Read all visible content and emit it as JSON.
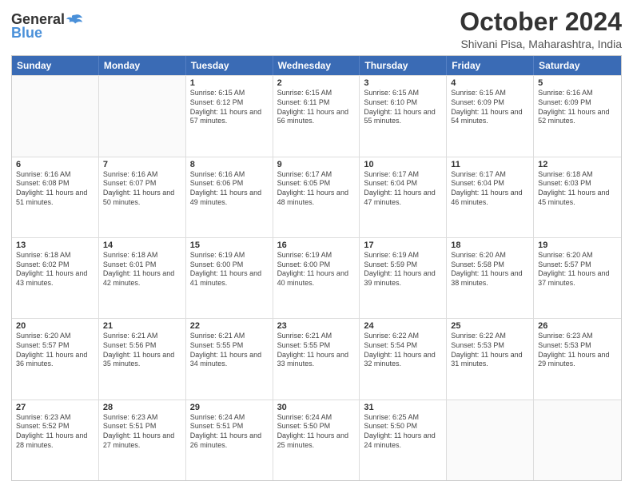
{
  "header": {
    "logo_general": "General",
    "logo_blue": "Blue",
    "month_title": "October 2024",
    "location": "Shivani Pisa, Maharashtra, India"
  },
  "calendar": {
    "days": [
      "Sunday",
      "Monday",
      "Tuesday",
      "Wednesday",
      "Thursday",
      "Friday",
      "Saturday"
    ],
    "rows": [
      [
        {
          "day": "",
          "sunrise": "",
          "sunset": "",
          "daylight": "",
          "empty": true
        },
        {
          "day": "",
          "sunrise": "",
          "sunset": "",
          "daylight": "",
          "empty": true
        },
        {
          "day": "1",
          "sunrise": "Sunrise: 6:15 AM",
          "sunset": "Sunset: 6:12 PM",
          "daylight": "Daylight: 11 hours and 57 minutes."
        },
        {
          "day": "2",
          "sunrise": "Sunrise: 6:15 AM",
          "sunset": "Sunset: 6:11 PM",
          "daylight": "Daylight: 11 hours and 56 minutes."
        },
        {
          "day": "3",
          "sunrise": "Sunrise: 6:15 AM",
          "sunset": "Sunset: 6:10 PM",
          "daylight": "Daylight: 11 hours and 55 minutes."
        },
        {
          "day": "4",
          "sunrise": "Sunrise: 6:15 AM",
          "sunset": "Sunset: 6:09 PM",
          "daylight": "Daylight: 11 hours and 54 minutes."
        },
        {
          "day": "5",
          "sunrise": "Sunrise: 6:16 AM",
          "sunset": "Sunset: 6:09 PM",
          "daylight": "Daylight: 11 hours and 52 minutes."
        }
      ],
      [
        {
          "day": "6",
          "sunrise": "Sunrise: 6:16 AM",
          "sunset": "Sunset: 6:08 PM",
          "daylight": "Daylight: 11 hours and 51 minutes."
        },
        {
          "day": "7",
          "sunrise": "Sunrise: 6:16 AM",
          "sunset": "Sunset: 6:07 PM",
          "daylight": "Daylight: 11 hours and 50 minutes."
        },
        {
          "day": "8",
          "sunrise": "Sunrise: 6:16 AM",
          "sunset": "Sunset: 6:06 PM",
          "daylight": "Daylight: 11 hours and 49 minutes."
        },
        {
          "day": "9",
          "sunrise": "Sunrise: 6:17 AM",
          "sunset": "Sunset: 6:05 PM",
          "daylight": "Daylight: 11 hours and 48 minutes."
        },
        {
          "day": "10",
          "sunrise": "Sunrise: 6:17 AM",
          "sunset": "Sunset: 6:04 PM",
          "daylight": "Daylight: 11 hours and 47 minutes."
        },
        {
          "day": "11",
          "sunrise": "Sunrise: 6:17 AM",
          "sunset": "Sunset: 6:04 PM",
          "daylight": "Daylight: 11 hours and 46 minutes."
        },
        {
          "day": "12",
          "sunrise": "Sunrise: 6:18 AM",
          "sunset": "Sunset: 6:03 PM",
          "daylight": "Daylight: 11 hours and 45 minutes."
        }
      ],
      [
        {
          "day": "13",
          "sunrise": "Sunrise: 6:18 AM",
          "sunset": "Sunset: 6:02 PM",
          "daylight": "Daylight: 11 hours and 43 minutes."
        },
        {
          "day": "14",
          "sunrise": "Sunrise: 6:18 AM",
          "sunset": "Sunset: 6:01 PM",
          "daylight": "Daylight: 11 hours and 42 minutes."
        },
        {
          "day": "15",
          "sunrise": "Sunrise: 6:19 AM",
          "sunset": "Sunset: 6:00 PM",
          "daylight": "Daylight: 11 hours and 41 minutes."
        },
        {
          "day": "16",
          "sunrise": "Sunrise: 6:19 AM",
          "sunset": "Sunset: 6:00 PM",
          "daylight": "Daylight: 11 hours and 40 minutes."
        },
        {
          "day": "17",
          "sunrise": "Sunrise: 6:19 AM",
          "sunset": "Sunset: 5:59 PM",
          "daylight": "Daylight: 11 hours and 39 minutes."
        },
        {
          "day": "18",
          "sunrise": "Sunrise: 6:20 AM",
          "sunset": "Sunset: 5:58 PM",
          "daylight": "Daylight: 11 hours and 38 minutes."
        },
        {
          "day": "19",
          "sunrise": "Sunrise: 6:20 AM",
          "sunset": "Sunset: 5:57 PM",
          "daylight": "Daylight: 11 hours and 37 minutes."
        }
      ],
      [
        {
          "day": "20",
          "sunrise": "Sunrise: 6:20 AM",
          "sunset": "Sunset: 5:57 PM",
          "daylight": "Daylight: 11 hours and 36 minutes."
        },
        {
          "day": "21",
          "sunrise": "Sunrise: 6:21 AM",
          "sunset": "Sunset: 5:56 PM",
          "daylight": "Daylight: 11 hours and 35 minutes."
        },
        {
          "day": "22",
          "sunrise": "Sunrise: 6:21 AM",
          "sunset": "Sunset: 5:55 PM",
          "daylight": "Daylight: 11 hours and 34 minutes."
        },
        {
          "day": "23",
          "sunrise": "Sunrise: 6:21 AM",
          "sunset": "Sunset: 5:55 PM",
          "daylight": "Daylight: 11 hours and 33 minutes."
        },
        {
          "day": "24",
          "sunrise": "Sunrise: 6:22 AM",
          "sunset": "Sunset: 5:54 PM",
          "daylight": "Daylight: 11 hours and 32 minutes."
        },
        {
          "day": "25",
          "sunrise": "Sunrise: 6:22 AM",
          "sunset": "Sunset: 5:53 PM",
          "daylight": "Daylight: 11 hours and 31 minutes."
        },
        {
          "day": "26",
          "sunrise": "Sunrise: 6:23 AM",
          "sunset": "Sunset: 5:53 PM",
          "daylight": "Daylight: 11 hours and 29 minutes."
        }
      ],
      [
        {
          "day": "27",
          "sunrise": "Sunrise: 6:23 AM",
          "sunset": "Sunset: 5:52 PM",
          "daylight": "Daylight: 11 hours and 28 minutes."
        },
        {
          "day": "28",
          "sunrise": "Sunrise: 6:23 AM",
          "sunset": "Sunset: 5:51 PM",
          "daylight": "Daylight: 11 hours and 27 minutes."
        },
        {
          "day": "29",
          "sunrise": "Sunrise: 6:24 AM",
          "sunset": "Sunset: 5:51 PM",
          "daylight": "Daylight: 11 hours and 26 minutes."
        },
        {
          "day": "30",
          "sunrise": "Sunrise: 6:24 AM",
          "sunset": "Sunset: 5:50 PM",
          "daylight": "Daylight: 11 hours and 25 minutes."
        },
        {
          "day": "31",
          "sunrise": "Sunrise: 6:25 AM",
          "sunset": "Sunset: 5:50 PM",
          "daylight": "Daylight: 11 hours and 24 minutes."
        },
        {
          "day": "",
          "sunrise": "",
          "sunset": "",
          "daylight": "",
          "empty": true
        },
        {
          "day": "",
          "sunrise": "",
          "sunset": "",
          "daylight": "",
          "empty": true
        }
      ]
    ]
  }
}
